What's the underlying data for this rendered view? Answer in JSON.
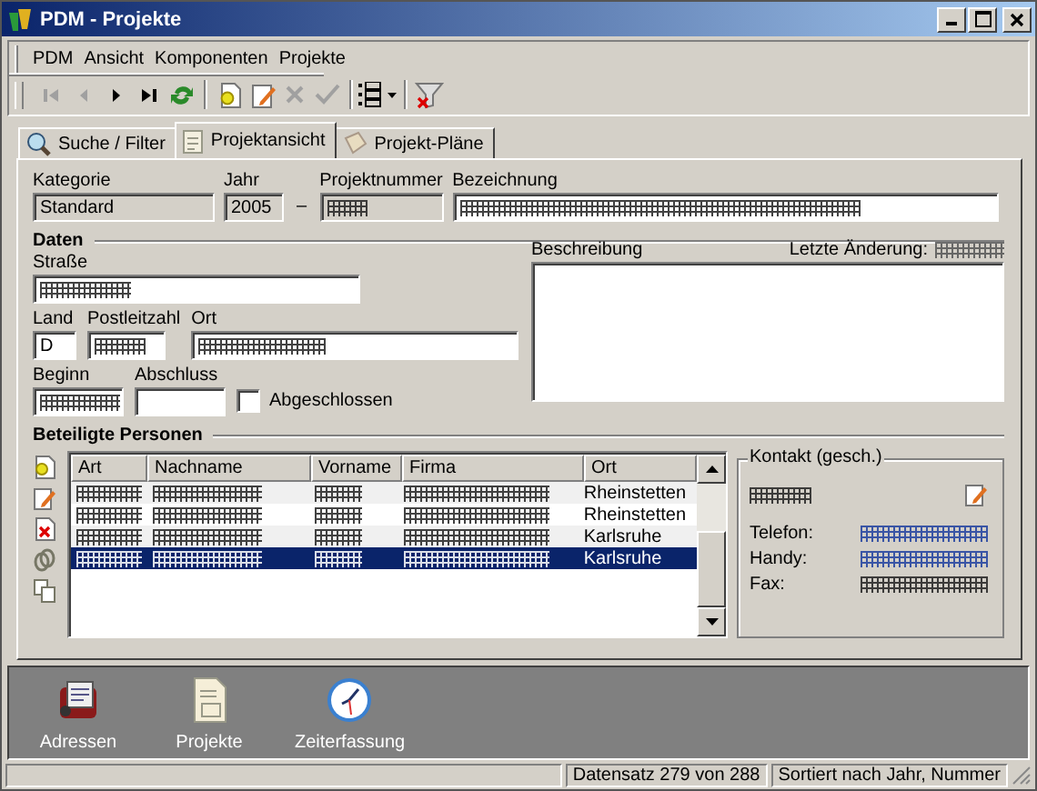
{
  "window": {
    "title": "PDM - Projekte"
  },
  "menu": [
    "PDM",
    "Ansicht",
    "Komponenten",
    "Projekte"
  ],
  "toolbar": [
    {
      "kind": "first",
      "disabled": true
    },
    {
      "kind": "prev",
      "disabled": true
    },
    {
      "kind": "next",
      "disabled": false
    },
    {
      "kind": "last",
      "disabled": false
    },
    {
      "kind": "refresh",
      "disabled": false
    },
    {
      "kind": "sep"
    },
    {
      "kind": "new",
      "disabled": false
    },
    {
      "kind": "edit",
      "disabled": false
    },
    {
      "kind": "cancel",
      "disabled": true
    },
    {
      "kind": "ok",
      "disabled": true
    },
    {
      "kind": "sep"
    },
    {
      "kind": "list",
      "disabled": false
    },
    {
      "kind": "sep"
    },
    {
      "kind": "filter",
      "disabled": false
    }
  ],
  "tabs": [
    {
      "label": "Suche / Filter",
      "kind": "search",
      "selected": false
    },
    {
      "label": "Projektansicht",
      "kind": "page",
      "selected": true
    },
    {
      "label": "Projekt-Pläne",
      "kind": "plans",
      "selected": false
    }
  ],
  "header_fields": [
    {
      "label": "Kategorie",
      "value": "Standard",
      "readonly": true,
      "obscured": false
    },
    {
      "label": "Jahr",
      "value": "2005",
      "readonly": true,
      "obscured": false
    },
    {
      "label": "Projektnummer",
      "readonly": true,
      "obscured": true
    },
    {
      "label": "Bezeichnung",
      "readonly": false,
      "obscured": true
    }
  ],
  "year_number_separator": "–",
  "daten": {
    "title": "Daten",
    "strasse": {
      "label": "Straße",
      "obscured": true
    },
    "land": {
      "label": "Land",
      "value": "D",
      "obscured": false
    },
    "postleitzahl": {
      "label": "Postleitzahl",
      "obscured": true
    },
    "ort": {
      "label": "Ort",
      "obscured": true
    },
    "beginn": {
      "label": "Beginn",
      "obscured": true
    },
    "abschluss": {
      "label": "Abschluss",
      "obscured": false
    },
    "abgeschlossen": {
      "label": "Abgeschlossen",
      "checked": false
    },
    "beschreibung": {
      "label": "Beschreibung"
    },
    "letzte_aenderung": {
      "label": "Letzte Änderung:",
      "obscured": true
    }
  },
  "personen": {
    "title": "Beteiligte Personen",
    "tools": [
      {
        "kind": "add"
      },
      {
        "kind": "edit"
      },
      {
        "kind": "delete"
      },
      {
        "kind": "link"
      },
      {
        "kind": "copy"
      }
    ],
    "columns": [
      "Art",
      "Nachname",
      "Vorname",
      "Firma",
      "Ort"
    ],
    "rows": [
      {
        "selected": false,
        "cells": [
          {
            "obscured": true
          },
          {
            "obscured": true
          },
          {
            "obscured": true
          },
          {
            "obscured": true
          },
          {
            "text": "Rheinstetten"
          }
        ]
      },
      {
        "selected": false,
        "cells": [
          {
            "obscured": true
          },
          {
            "obscured": true
          },
          {
            "obscured": true
          },
          {
            "obscured": true
          },
          {
            "text": "Rheinstetten"
          }
        ]
      },
      {
        "selected": false,
        "cells": [
          {
            "obscured": true
          },
          {
            "obscured": true
          },
          {
            "obscured": true
          },
          {
            "obscured": true
          },
          {
            "text": "Karlsruhe"
          }
        ]
      },
      {
        "selected": true,
        "cells": [
          {
            "obscured": true
          },
          {
            "obscured": true
          },
          {
            "obscured": true
          },
          {
            "obscured": true
          },
          {
            "text": "Karlsruhe"
          }
        ]
      }
    ]
  },
  "kontakt": {
    "title": "Kontakt (gesch.)",
    "name_obscured": true,
    "fields": [
      {
        "label": "Telefon:",
        "kind": "link",
        "obscured": true
      },
      {
        "label": "Handy:",
        "kind": "link",
        "obscured": true
      },
      {
        "label": "Fax:",
        "kind": "text",
        "obscured": true
      }
    ]
  },
  "launcher": [
    {
      "label": "Adressen",
      "kind": "addressbook"
    },
    {
      "label": "Projekte",
      "kind": "document"
    },
    {
      "label": "Zeiterfassung",
      "kind": "clock"
    }
  ],
  "status_bar": [
    "Datensatz 279 von 288",
    "Sortiert nach Jahr, Nummer"
  ]
}
